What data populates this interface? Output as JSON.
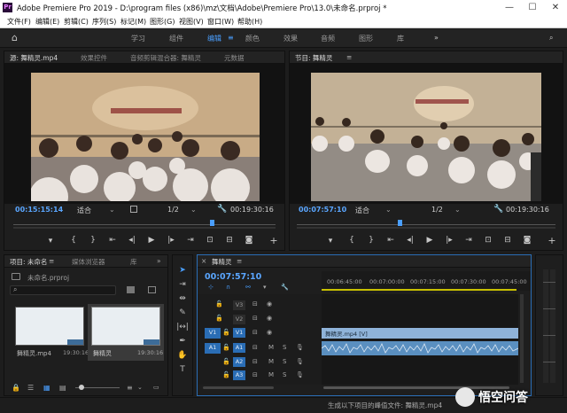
{
  "titlebar": {
    "app_icon": "Pr",
    "title": "Adobe Premiere Pro 2019 - D:\\program files (x86)\\mz\\文档\\Adobe\\Premiere Pro\\13.0\\未命名.prproj *",
    "controls": [
      "minimize-icon",
      "maximize-icon",
      "close-icon"
    ]
  },
  "menu": [
    "文件(F)",
    "编辑(E)",
    "剪辑(C)",
    "序列(S)",
    "标记(M)",
    "图形(G)",
    "视图(V)",
    "窗口(W)",
    "帮助(H)"
  ],
  "workspaces": [
    "学习",
    "组件",
    "编辑",
    "颜色",
    "效果",
    "音频",
    "图形",
    "库"
  ],
  "workspace_active": "编辑",
  "source_monitor": {
    "tabs": [
      "源: 舞精灵.mp4",
      "效果控件",
      "音频剪辑混合器: 舞精灵",
      "元数据"
    ],
    "timecode_in": "00:15:15:14",
    "fit": "适合",
    "resolution": "1/2",
    "duration": "00:19:30:16"
  },
  "program_monitor": {
    "tab": "节目: 舞精灵",
    "timecode_in": "00:07:57:10",
    "fit": "适合",
    "resolution": "1/2",
    "duration": "00:19:30:16"
  },
  "project_panel": {
    "tabs": [
      "项目: 未命名",
      "媒体浏览器",
      "库"
    ],
    "project_file": "未命名.prproj",
    "items": [
      {
        "name": "舞精灵.mp4",
        "duration": "19:30:16"
      },
      {
        "name": "舞精灵",
        "duration": "19:30:16"
      }
    ]
  },
  "timeline": {
    "tab": "舞精灵",
    "timecode": "00:07:57:10",
    "ruler": [
      "00:06:45:00",
      "00:07:00:00",
      "00:07:15:00",
      "00:07:30:00",
      "00:07:45:00"
    ],
    "video_tracks": [
      "V3",
      "V2",
      "V1"
    ],
    "audio_tracks": [
      "A1",
      "A2",
      "A3"
    ],
    "source_patch": {
      "video": "V1",
      "audio": "A1"
    },
    "clip_video_label": "舞精灵.mp4 [V]",
    "track_toggle_labels": {
      "mute": "M",
      "solo": "S"
    }
  },
  "status_bar": {
    "text": "生成以下项目的峰值文件: 舞精灵.mp4"
  },
  "watermark": "悟空问答",
  "colors": {
    "accent_blue": "#4a9fff",
    "timecode_blue": "#5aa6ff",
    "clip_video": "#8fb3d9",
    "clip_audio": "#5a8fc0",
    "target_blue": "#2a6db5"
  }
}
